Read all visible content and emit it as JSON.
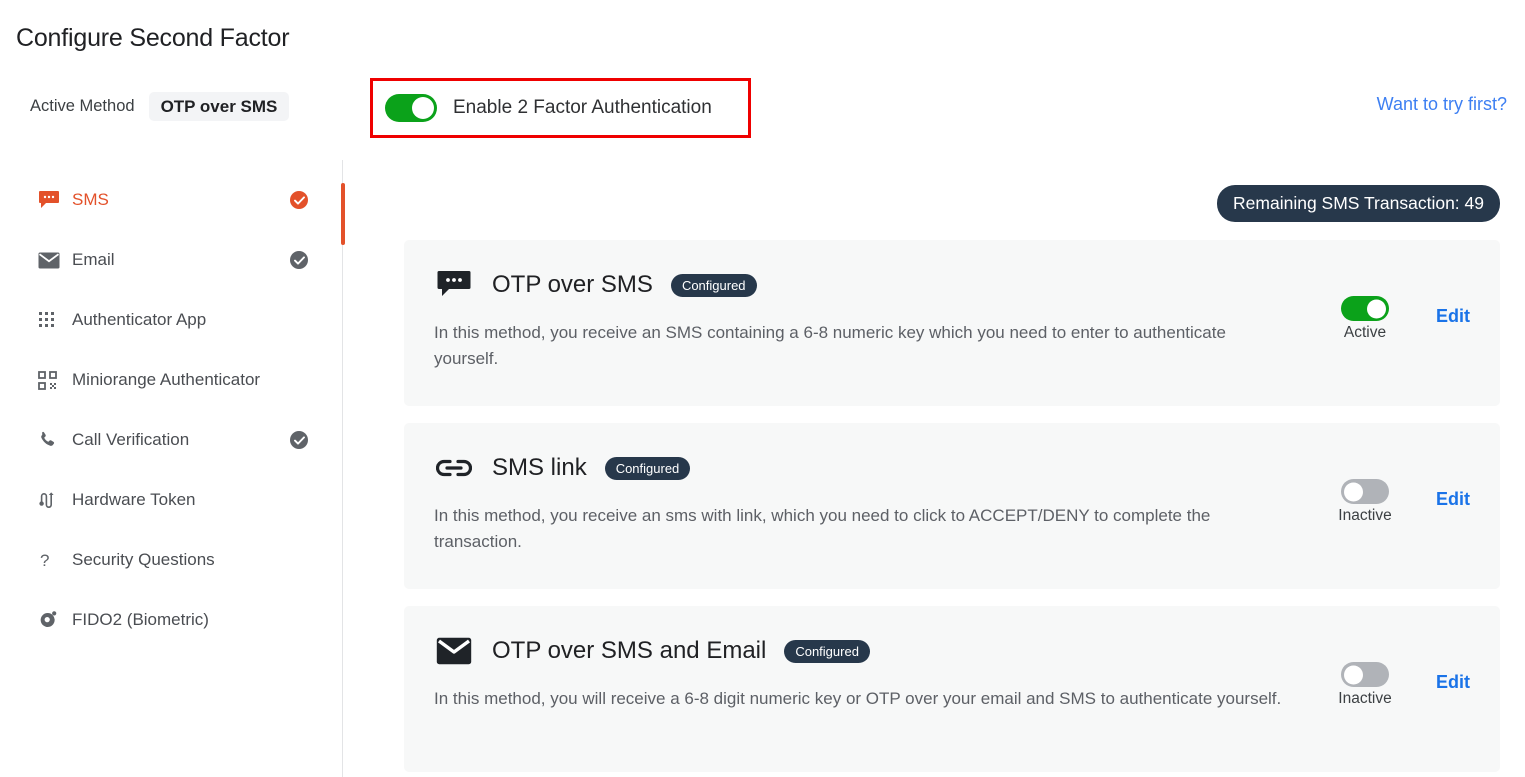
{
  "header": {
    "title": "Configure Second Factor",
    "active_method_label": "Active Method",
    "active_method_value": "OTP over SMS",
    "enable_toggle_label": "Enable 2 Factor Authentication",
    "enable_toggle_state": "on",
    "try_first_link": "Want to try first?",
    "highlight_color": "#ef0000",
    "toggle_on_color": "#0ba21a"
  },
  "sidebar": {
    "items": [
      {
        "label": "SMS",
        "icon": "sms-chat-icon",
        "active": true,
        "configured": true
      },
      {
        "label": "Email",
        "icon": "envelope-icon",
        "active": false,
        "configured": true
      },
      {
        "label": "Authenticator App",
        "icon": "grid-dots-icon",
        "active": false,
        "configured": false
      },
      {
        "label": "Miniorange Authenticator",
        "icon": "qr-code-icon",
        "active": false,
        "configured": false
      },
      {
        "label": "Call Verification",
        "icon": "phone-icon",
        "active": false,
        "configured": true
      },
      {
        "label": "Hardware Token",
        "icon": "usb-token-icon",
        "active": false,
        "configured": false
      },
      {
        "label": "Security Questions",
        "icon": "question-mark-icon",
        "active": false,
        "configured": false
      },
      {
        "label": "FIDO2 (Biometric)",
        "icon": "fido-fingerprint-icon",
        "active": false,
        "configured": false
      }
    ],
    "active_color": "#e3512a"
  },
  "main": {
    "remaining_badge": "Remaining SMS Transaction: 49",
    "badge_color": "#27384b",
    "edit_link_color": "#1a73e8",
    "cards": [
      {
        "icon": "sms-chat-icon",
        "title": "OTP over SMS",
        "badge": "Configured",
        "description": "In this method, you receive an SMS containing a 6-8 numeric key which you need to enter to authenticate yourself.",
        "toggle_state": "on",
        "state_label": "Active",
        "edit_label": "Edit"
      },
      {
        "icon": "link-chain-icon",
        "title": "SMS link",
        "badge": "Configured",
        "description": "In this method, you receive an sms with link, which you need to click to ACCEPT/DENY to complete the transaction.",
        "toggle_state": "off",
        "state_label": "Inactive",
        "edit_label": "Edit"
      },
      {
        "icon": "envelope-icon",
        "title": "OTP over SMS and Email",
        "badge": "Configured",
        "description": "In this method, you will receive a 6-8 digit numeric key or OTP over your email and SMS to authenticate yourself.",
        "toggle_state": "off",
        "state_label": "Inactive",
        "edit_label": "Edit"
      }
    ]
  }
}
